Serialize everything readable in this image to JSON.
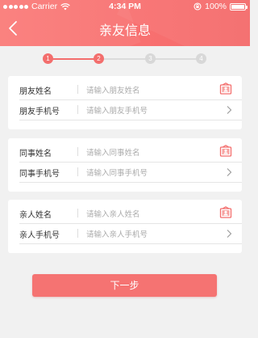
{
  "status_bar": {
    "carrier": "Carrier",
    "time": "4:34 PM",
    "battery": "100%"
  },
  "nav": {
    "title": "亲友信息",
    "back_icon": "chevron-left-icon"
  },
  "steps": {
    "items": [
      "1",
      "2",
      "3",
      "4"
    ],
    "current": 2,
    "active_color": "#f36e6d",
    "inactive_color": "#dcdcdc"
  },
  "cards": [
    {
      "rows": [
        {
          "label": "朋友姓名",
          "placeholder": "请输入朋友姓名",
          "icon": "contacts-book-icon"
        },
        {
          "label": "朋友手机号",
          "placeholder": "请输入朋友手机号",
          "icon": "chevron-right-icon"
        }
      ]
    },
    {
      "rows": [
        {
          "label": "同事姓名",
          "placeholder": "请输入同事姓名",
          "icon": "contacts-book-icon"
        },
        {
          "label": "同事手机号",
          "placeholder": "请输入同事手机号",
          "icon": "chevron-right-icon"
        }
      ]
    },
    {
      "rows": [
        {
          "label": "亲人姓名",
          "placeholder": "请输入亲人姓名",
          "icon": "contacts-book-icon"
        },
        {
          "label": "亲人手机号",
          "placeholder": "请输入亲人手机号",
          "icon": "chevron-right-icon"
        }
      ]
    }
  ],
  "next_button": {
    "label": "下一步"
  },
  "colors": {
    "accent": "#f57372",
    "header": "#f87070",
    "background": "#f1f1f1"
  }
}
